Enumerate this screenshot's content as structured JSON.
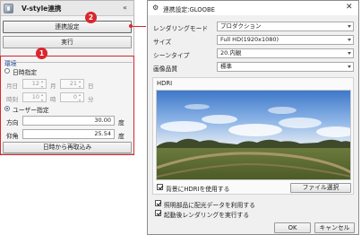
{
  "left_panel": {
    "title": "V-style連携",
    "collapse_icon": "«",
    "link_settings_button": "連携設定",
    "run_button": "実行",
    "environment_label": "環境",
    "datetime_radio": "日時指定",
    "month_label": "月日",
    "month_value": "12",
    "month_unit": "月",
    "day_value": "21",
    "day_unit": "日",
    "time_label": "時刻",
    "hour_value": "10",
    "hour_unit": "時",
    "minute_value": "0",
    "minute_unit": "分",
    "user_radio": "ユーザー指定",
    "direction_label": "方向",
    "direction_value": "30.00",
    "direction_unit": "度",
    "elevation_label": "仰角",
    "elevation_value": "25.54",
    "elevation_unit": "度",
    "reload_button": "日時から再取込み"
  },
  "callouts": {
    "one": "1",
    "two": "2"
  },
  "dialog": {
    "title": "連携設定:GLOOBE",
    "close_icon": "✕",
    "rendering_mode_label": "レンダリングモード",
    "rendering_mode_value": "プロダクション",
    "size_label": "サイズ",
    "size_value": "Full HD(1920x1080)",
    "scene_type_label": "シーンタイプ",
    "scene_type_value": "20.内観",
    "image_quality_label": "画像品質",
    "image_quality_value": "標準",
    "hdri_label": "HDRI",
    "use_hdri_background": "背景にHDRIを使用する",
    "use_hdri_background_checked": true,
    "file_select_button": "ファイル選択",
    "use_lighting_data": "照明部品に配光データを利用する",
    "use_lighting_data_checked": true,
    "render_after_start": "起動後レンダリングを実行する",
    "render_after_start_checked": true,
    "ok_button": "OK",
    "cancel_button": "キャンセル"
  },
  "colors": {
    "accent_red": "#d9262d",
    "environment_label": "#1a3f8f",
    "radio_selected": "#1b5dc8"
  },
  "icons": {
    "panel_logo": "vstyle-logo-icon",
    "collapse": "double-chevron-up-icon",
    "dialog": "gear-icon",
    "close": "close-icon"
  }
}
